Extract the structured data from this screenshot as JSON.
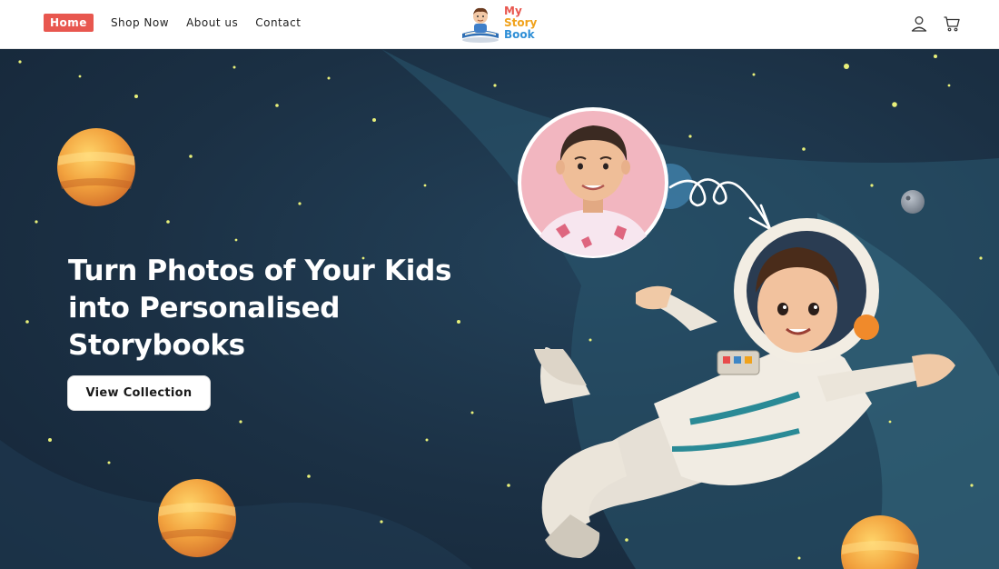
{
  "nav": {
    "items": [
      {
        "label": "Home",
        "active": true
      },
      {
        "label": "Shop Now",
        "active": false
      },
      {
        "label": "About us",
        "active": false
      },
      {
        "label": "Contact",
        "active": false
      }
    ],
    "active_color": "#e8574f"
  },
  "logo": {
    "line1": "My",
    "line2": "Story",
    "line3": "Book"
  },
  "header_icons": [
    "account-icon",
    "cart-icon"
  ],
  "hero": {
    "headline": "Turn Photos of Your Kids into Personalised Storybooks",
    "cta_label": "View Collection",
    "background_color": "#1b3044"
  }
}
